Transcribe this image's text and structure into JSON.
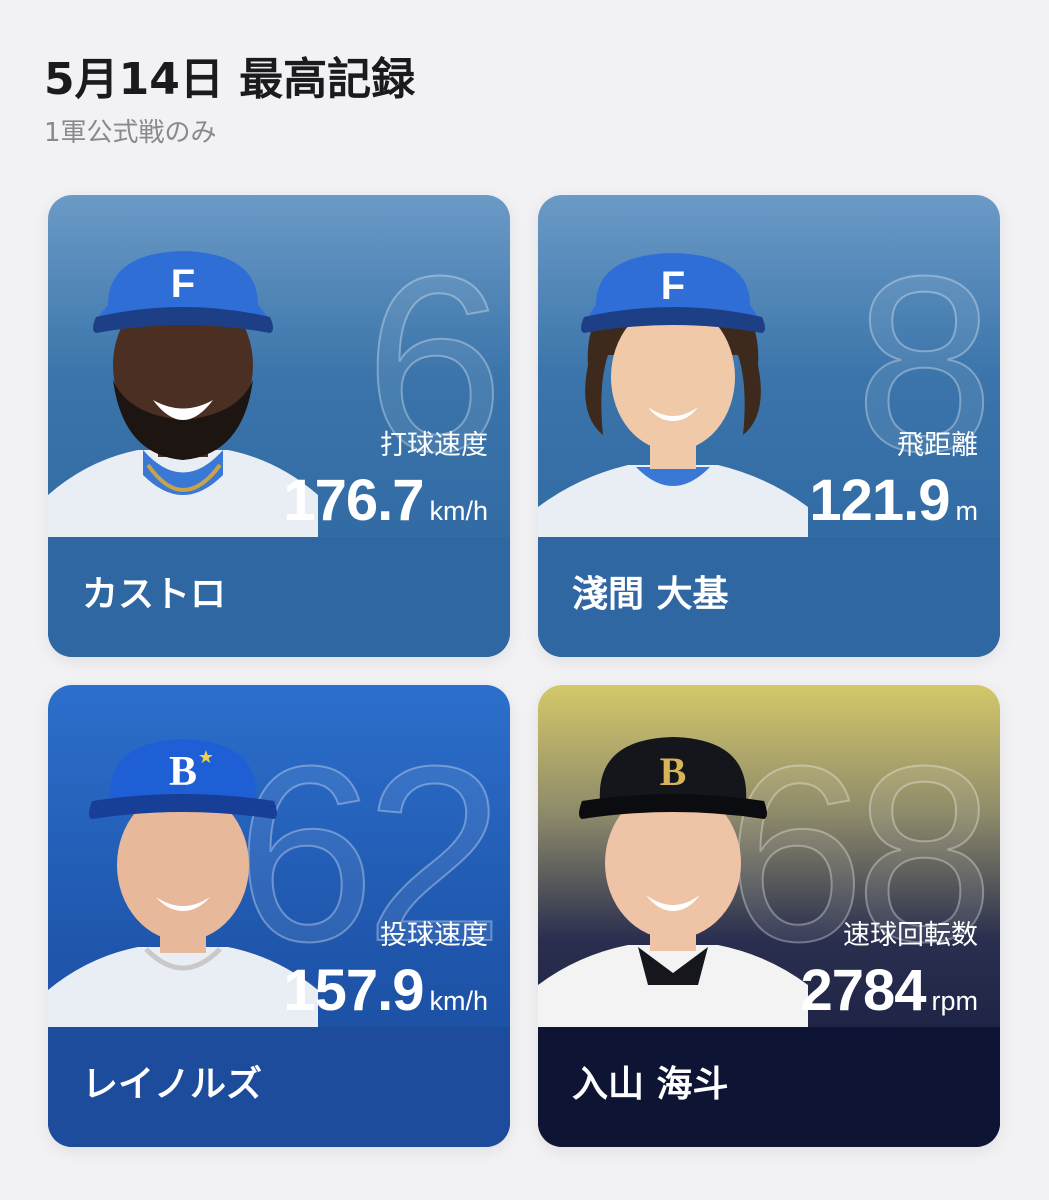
{
  "header": {
    "title": "5月14日 最高記録",
    "subtitle": "1軍公式戦のみ"
  },
  "cards": [
    {
      "number": "6",
      "stat_label": "打球速度",
      "value": "176.7",
      "unit": "km/h",
      "name": "カストロ",
      "cap_letter": "F",
      "cap_color": "#2e6ed6",
      "skin": "#4a2f22",
      "theme": "#2f67a2"
    },
    {
      "number": "8",
      "stat_label": "飛距離",
      "value": "121.9",
      "unit": "m",
      "name": "淺間 大基",
      "cap_letter": "F",
      "cap_color": "#2e6ed6",
      "skin": "#f0c9a8",
      "theme": "#2f67a2"
    },
    {
      "number": "62",
      "stat_label": "投球速度",
      "value": "157.9",
      "unit": "km/h",
      "name": "レイノルズ",
      "cap_letter": "B",
      "cap_color": "#1f5fd6",
      "skin": "#e8b89a",
      "theme": "#1c4c9b"
    },
    {
      "number": "68",
      "stat_label": "速球回転数",
      "value": "2784",
      "unit": "rpm",
      "name": "入山 海斗",
      "cap_letter": "B",
      "cap_color": "#14161c",
      "skin": "#efc3a6",
      "theme": "#0e1433"
    }
  ]
}
